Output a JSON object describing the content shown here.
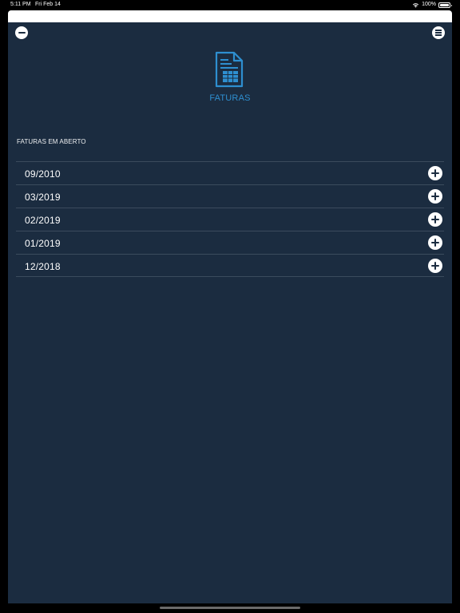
{
  "status_bar": {
    "time": "5:11 PM",
    "date": "Fri Feb 14",
    "battery": "100%",
    "icons": [
      "wifi-icon",
      "battery-icon"
    ]
  },
  "header": {
    "left_button_icon": "minus-circle-icon",
    "right_button_icon": "menu-icon",
    "hero_icon": "invoice-document-icon",
    "title": "FATURAS"
  },
  "section": {
    "label": "FATURAS EM ABERTO"
  },
  "invoices": [
    {
      "label": "09/2010",
      "action_icon": "plus-circle-icon"
    },
    {
      "label": "03/2019",
      "action_icon": "plus-circle-icon"
    },
    {
      "label": "02/2019",
      "action_icon": "plus-circle-icon"
    },
    {
      "label": "01/2019",
      "action_icon": "plus-circle-icon"
    },
    {
      "label": "12/2018",
      "action_icon": "plus-circle-icon"
    }
  ],
  "colors": {
    "background": "#1b2c40",
    "accent": "#2e8fd0",
    "divider": "#3b4b5d",
    "text": "#ffffff"
  }
}
